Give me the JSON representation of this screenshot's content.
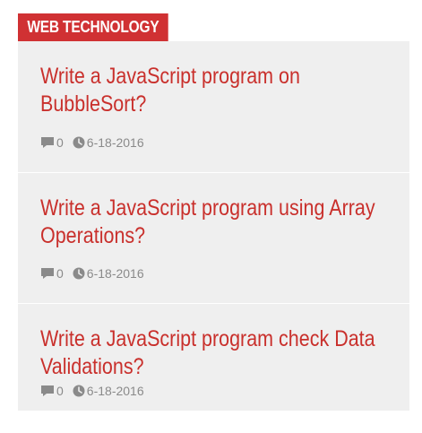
{
  "header": {
    "title": "WEB TECHNOLOGY"
  },
  "posts": [
    {
      "title": "Write a JavaScript program on BubbleSort?",
      "comments": "0",
      "date": "6-18-2016"
    },
    {
      "title": "Write a JavaScript program using Array Operations?",
      "comments": "0",
      "date": "6-18-2016"
    },
    {
      "title": "Write a JavaScript program check Data Validations?",
      "comments": "0",
      "date": "6-18-2016"
    }
  ],
  "icons": {
    "comment": "comment-icon",
    "clock": "clock-icon"
  },
  "colors": {
    "accent": "#d03133",
    "title": "#c9302c",
    "card_bg": "#efefef",
    "meta": "#8a8a8a"
  }
}
